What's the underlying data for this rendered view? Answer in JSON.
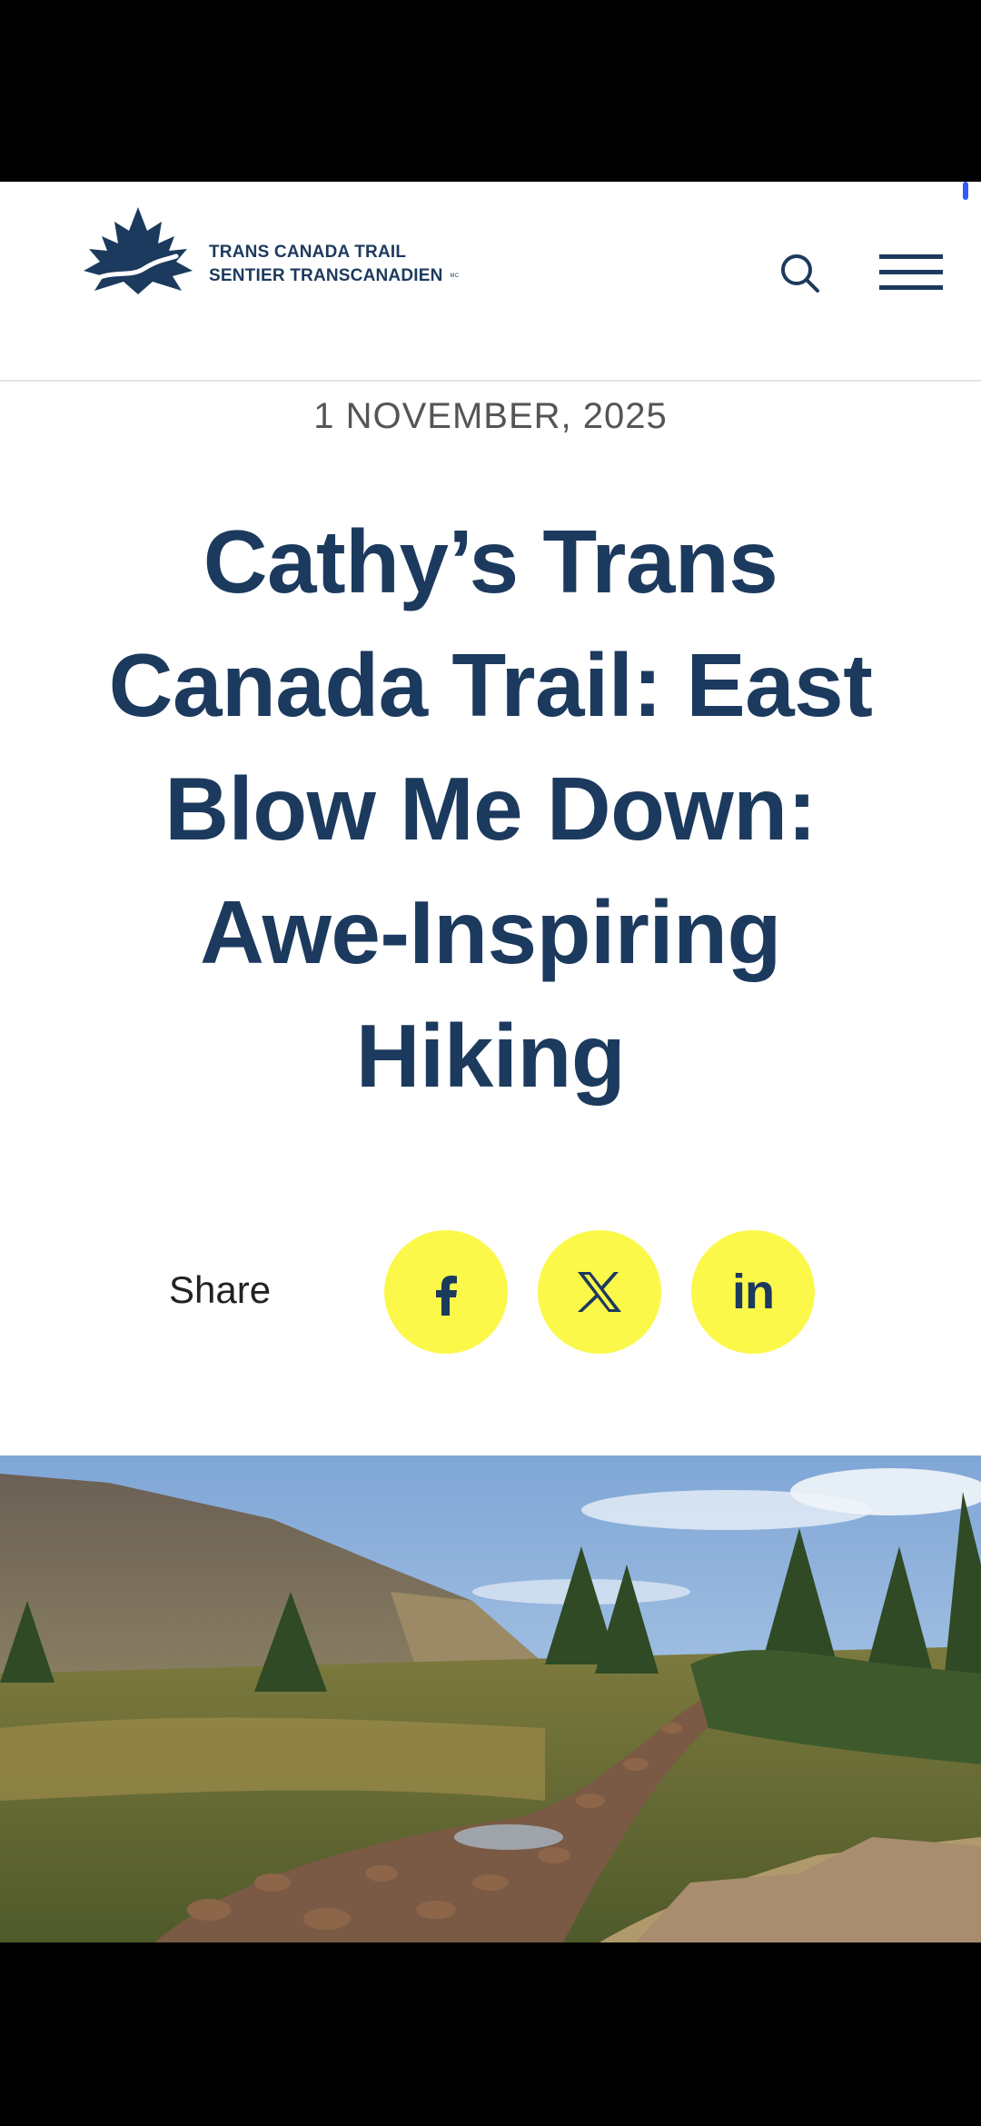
{
  "logo": {
    "line1": "TRANS CANADA TRAIL",
    "line2": "SENTIER TRANSCANADIEN",
    "trademark": "MC",
    "color": "#1c3a5e"
  },
  "header": {
    "search_icon": "search-icon",
    "menu_icon": "hamburger-menu-icon"
  },
  "article": {
    "date": "1 NOVEMBER, 2025",
    "title": "Cathy’s Trans Canada Trail: East Blow Me Down: Awe-Inspiring Hiking",
    "title_color": "#1c3a5e"
  },
  "share": {
    "label": "Share",
    "button_color": "#fbf84a",
    "buttons": [
      {
        "network": "facebook",
        "icon": "facebook-icon"
      },
      {
        "network": "x",
        "icon": "x-icon"
      },
      {
        "network": "linkedin",
        "icon": "linkedin-icon",
        "glyph": "in"
      }
    ]
  },
  "hero": {
    "subject": "photo of a rocky stream running through a green valley with spruce trees and a mountain slope under a blue sky"
  }
}
